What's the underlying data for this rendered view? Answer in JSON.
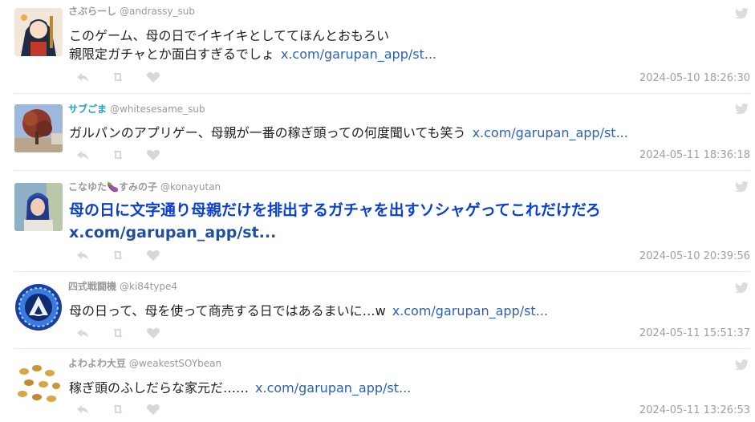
{
  "tweets": [
    {
      "display_name": "さぶらーし",
      "handle": "@andrassy_sub",
      "text_lines": [
        "このゲーム、母の日でイキイキとしててほんとおもろい",
        "親限定ガチャとか面白すぎるでしょ"
      ],
      "link": "x.com/garupan_app/st...",
      "timestamp": "2024-05-10 18:26:30",
      "name_color": "#999999"
    },
    {
      "display_name": "サブごま",
      "handle": "@whitesesame_sub",
      "text_lines": [
        "ガルパンのアプリゲー、母親が一番の稼ぎ頭っての何度聞いても笑う"
      ],
      "link": "x.com/garupan_app/st...",
      "timestamp": "2024-05-11 18:36:18",
      "name_color": "#1da1c8"
    },
    {
      "display_name": "こなゆた🍆すみの子",
      "handle": "@konayutan",
      "text_lines": [
        "母の日に文字通り母親だけを排出するガチャを出すソシャゲってこれだけだろ"
      ],
      "link": "x.com/garupan_app/st...",
      "timestamp": "2024-05-10 20:39:56",
      "name_color": "#999999",
      "highlighted": true
    },
    {
      "display_name": "四式戦闘機",
      "handle": "@ki84type4",
      "text_lines": [
        "母の日って、母を使って商売する日ではあるまいに…w"
      ],
      "link": "x.com/garupan_app/st...",
      "timestamp": "2024-05-11 15:51:37",
      "name_color": "#999999"
    },
    {
      "display_name": "よわよわ大豆",
      "handle": "@weakestSOYbean",
      "text_lines": [
        "稼ぎ頭のふしだらな家元だ……"
      ],
      "link": "x.com/garupan_app/st...",
      "timestamp": "2024-05-11 13:26:53",
      "name_color": "#999999"
    }
  ],
  "icons": {
    "reply": "reply-icon",
    "retweet": "retweet-icon",
    "like": "heart-icon",
    "platform": "twitter-bird-icon"
  },
  "colors": {
    "link": "#2b62b5",
    "highlight_text": "#0a3fd6",
    "muted": "#999999",
    "separator": "#e6ecf0"
  }
}
